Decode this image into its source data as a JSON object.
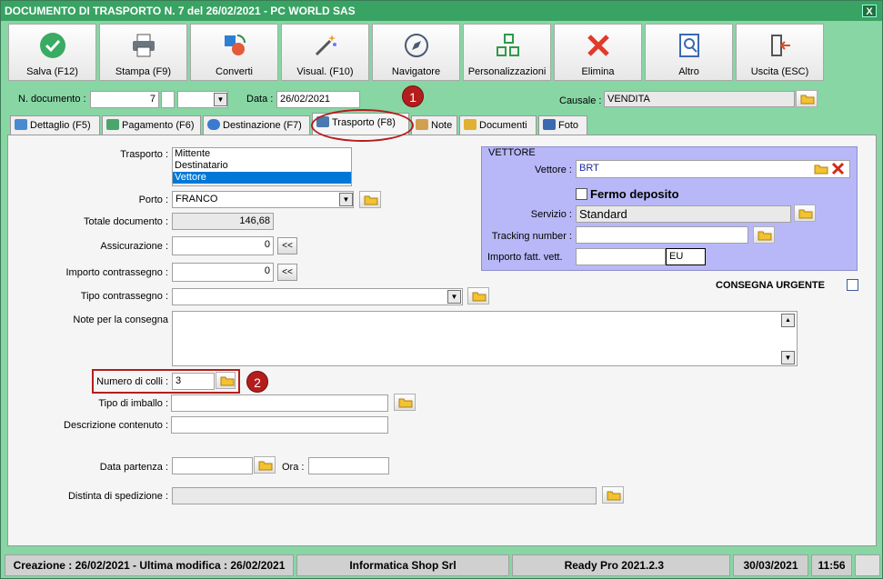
{
  "window": {
    "title": "DOCUMENTO DI TRASPORTO N. 7 del 26/02/2021 - PC WORLD SAS",
    "close_label": "X"
  },
  "toolbar": [
    {
      "label": "Salva (F12)",
      "icon": "check-circle-icon"
    },
    {
      "label": "Stampa (F9)",
      "icon": "printer-icon"
    },
    {
      "label": "Converti",
      "icon": "convert-icon"
    },
    {
      "label": "Visual. (F10)",
      "icon": "magic-wand-icon"
    },
    {
      "label": "Navigatore",
      "icon": "compass-icon"
    },
    {
      "label": "Personalizzazioni",
      "icon": "grid-icon"
    },
    {
      "label": "Elimina",
      "icon": "x-icon"
    },
    {
      "label": "Altro",
      "icon": "search-doc-icon"
    },
    {
      "label": "Uscita (ESC)",
      "icon": "exit-icon"
    }
  ],
  "header": {
    "num_doc_label": "N. documento :",
    "num_doc_value": "7",
    "data_label": "Data :",
    "data_value": "26/02/2021",
    "causale_label": "Causale :",
    "causale_value": "VENDITA"
  },
  "tabs": [
    "Dettaglio (F5)",
    "Pagamento (F6)",
    "Destinazione (F7)",
    "Trasporto (F8)",
    "Note",
    "Documenti",
    "Foto"
  ],
  "trasporto": {
    "trasporto_label": "Trasporto :",
    "trasporto_options": [
      "Mittente",
      "Destinatario",
      "Vettore"
    ],
    "trasporto_selected": "Vettore",
    "porto_label": "Porto :",
    "porto_value": "FRANCO",
    "totale_label": "Totale documento :",
    "totale_value": "146,68",
    "assicurazione_label": "Assicurazione :",
    "assicurazione_value": "0",
    "contrassegno_label": "Importo contrassegno :",
    "contrassegno_value": "0",
    "tipo_contrassegno_label": "Tipo contrassegno :",
    "tipo_contrassegno_value": "",
    "note_label": "Note per la consegna",
    "note_value": "",
    "colli_label": "Numero di colli :",
    "colli_value": "3",
    "imballo_label": "Tipo di imballo :",
    "imballo_value": "",
    "descr_label": "Descrizione contenuto :",
    "descr_value": "",
    "data_partenza_label": "Data partenza :",
    "data_partenza_value": "",
    "ora_label": "Ora :",
    "ora_value": "",
    "distinta_label": "Distinta di spedizione :",
    "distinta_value": "",
    "copy_btn": "<<"
  },
  "vettore": {
    "group_title": "VETTORE",
    "vettore_label": "Vettore :",
    "vettore_value": "BRT",
    "fermo_label": "Fermo deposito",
    "servizio_label": "Servizio :",
    "servizio_value": "Standard",
    "tracking_label": "Tracking number :",
    "tracking_value": "",
    "importo_label": "Importo fatt. vett.",
    "importo_value": "",
    "currency": "EU",
    "urgente_label": "CONSEGNA URGENTE"
  },
  "callouts": [
    "1",
    "2"
  ],
  "status": {
    "dates": "Creazione : 26/02/2021 - Ultima modifica : 26/02/2021",
    "company": "Informatica Shop Srl",
    "version": "Ready Pro 2021.2.3",
    "date": "30/03/2021",
    "time": "11:56"
  },
  "colors": {
    "accent": "#38a362",
    "background": "#87d6a4",
    "vettore_panel": "#b8b8f8",
    "callout": "#b51d1d"
  }
}
